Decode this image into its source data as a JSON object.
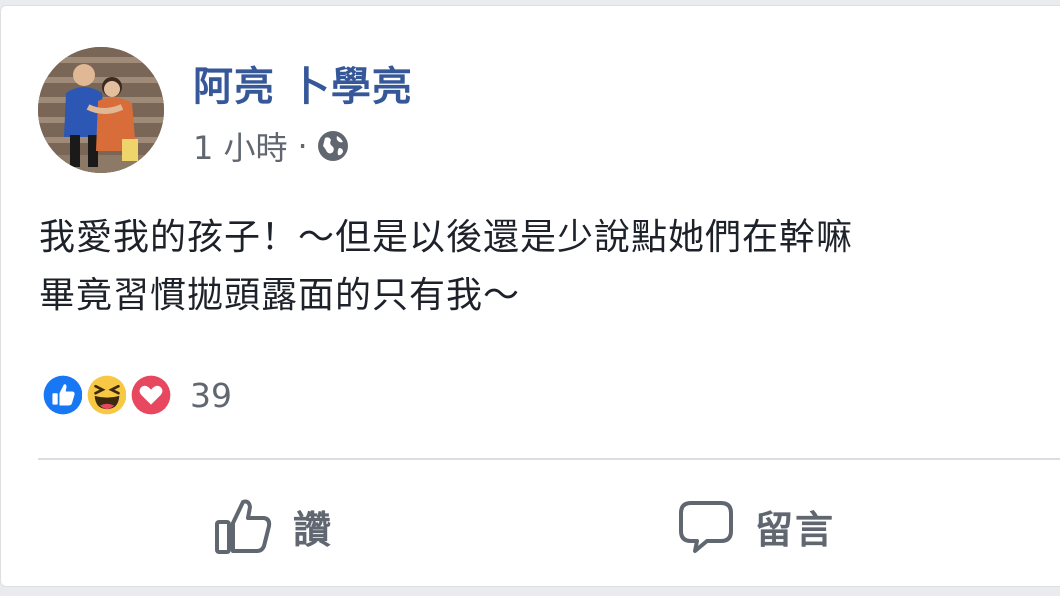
{
  "post": {
    "author_name": "阿亮 卜學亮",
    "timestamp": "1 小時",
    "separator": "·",
    "privacy_icon": "globe-icon",
    "text_lines": [
      "我愛我的孩子！～但是以後還是少說點她們在幹嘛",
      "畢竟習慣拋頭露面的只有我～"
    ]
  },
  "reactions": {
    "icons": [
      "like-reaction-icon",
      "haha-reaction-icon",
      "love-reaction-icon"
    ],
    "count": "39"
  },
  "actions": {
    "like_label": "讚",
    "comment_label": "留言"
  },
  "colors": {
    "author_link": "#365899",
    "secondary_text": "#606770",
    "like_blue": "#1877f2",
    "haha_yellow": "#f7c843",
    "love_red": "#e8485f"
  }
}
